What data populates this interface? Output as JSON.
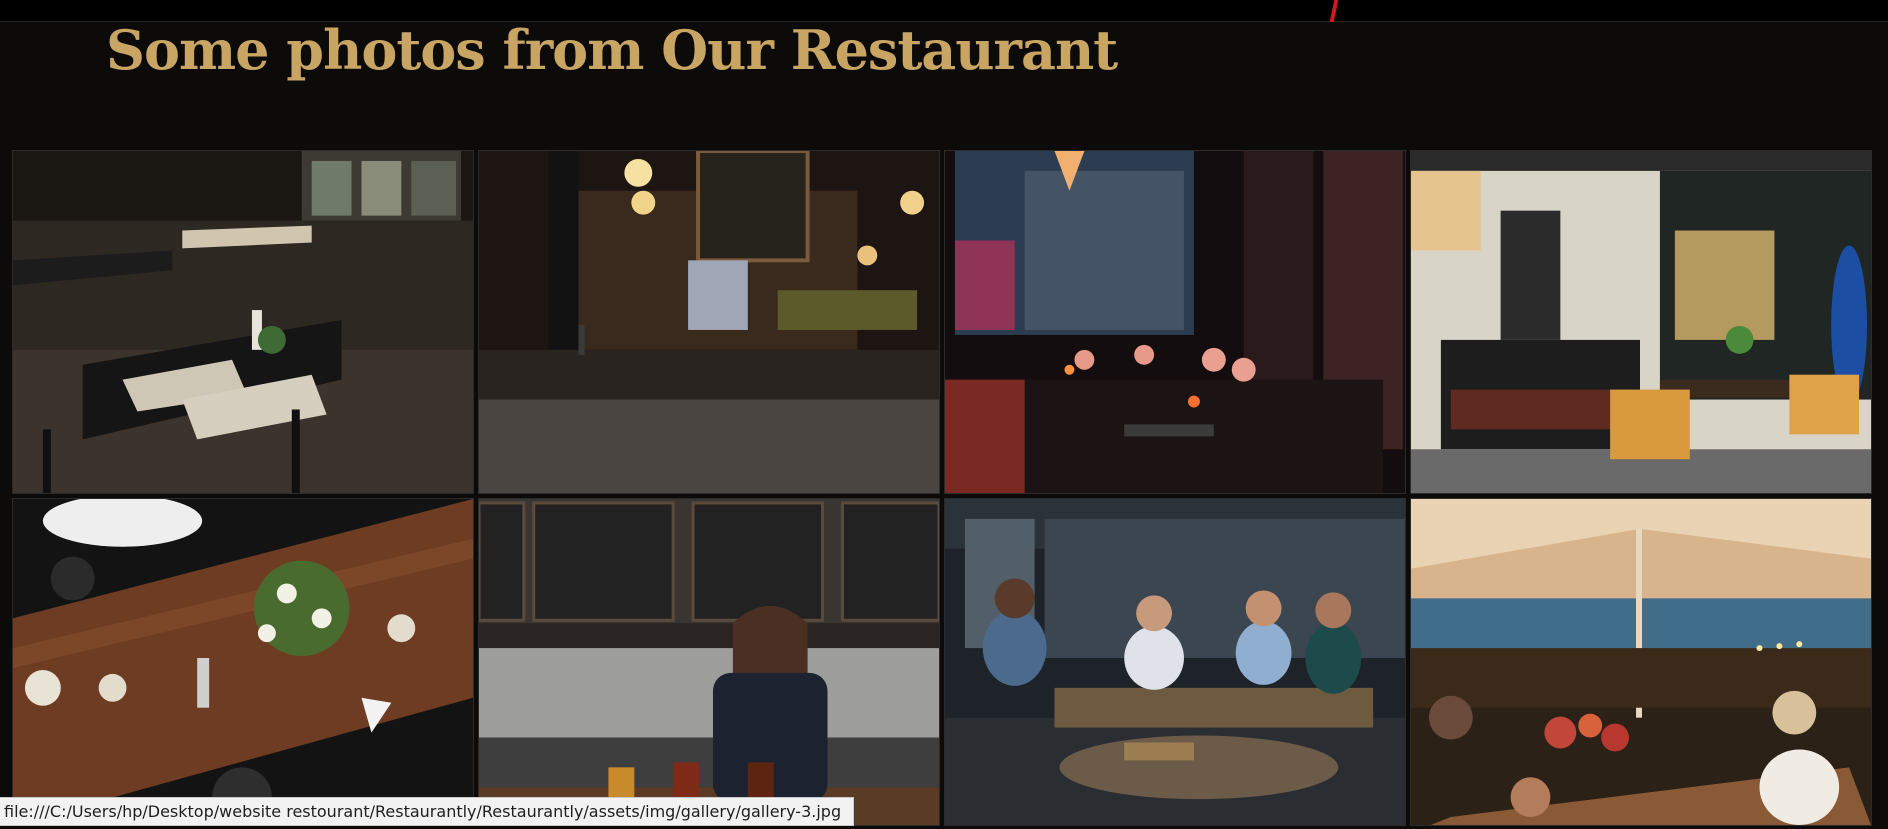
{
  "section": {
    "title": "Some photos from Our Restaurant"
  },
  "gallery": {
    "photos": [
      {
        "name": "gallery-photo-1",
        "subject": "empty dining room with tables and chairs"
      },
      {
        "name": "gallery-photo-2",
        "subject": "bar interior with pendant lamps and chalkboard menu"
      },
      {
        "name": "gallery-photo-3",
        "subject": "table with wine glasses and candles by the window"
      },
      {
        "name": "gallery-photo-4",
        "subject": "modern dining area with chairs and shelves"
      },
      {
        "name": "gallery-photo-5",
        "subject": "wooden table seen from above with flowers and plates"
      },
      {
        "name": "gallery-photo-6",
        "subject": "bartender in front of beer taps and menu boards"
      },
      {
        "name": "gallery-photo-7",
        "subject": "friends laughing around a table on a terrace"
      },
      {
        "name": "gallery-photo-8",
        "subject": "outdoor dinner party under a tent raising glasses"
      }
    ]
  },
  "status_bar": {
    "url": "file:///C:/Users/hp/Desktop/website restourant/Restaurantly/Restaurantly/assets/img/gallery/gallery-3.jpg"
  },
  "colors": {
    "accent": "#c9a564",
    "background": "#0c0b0a"
  }
}
